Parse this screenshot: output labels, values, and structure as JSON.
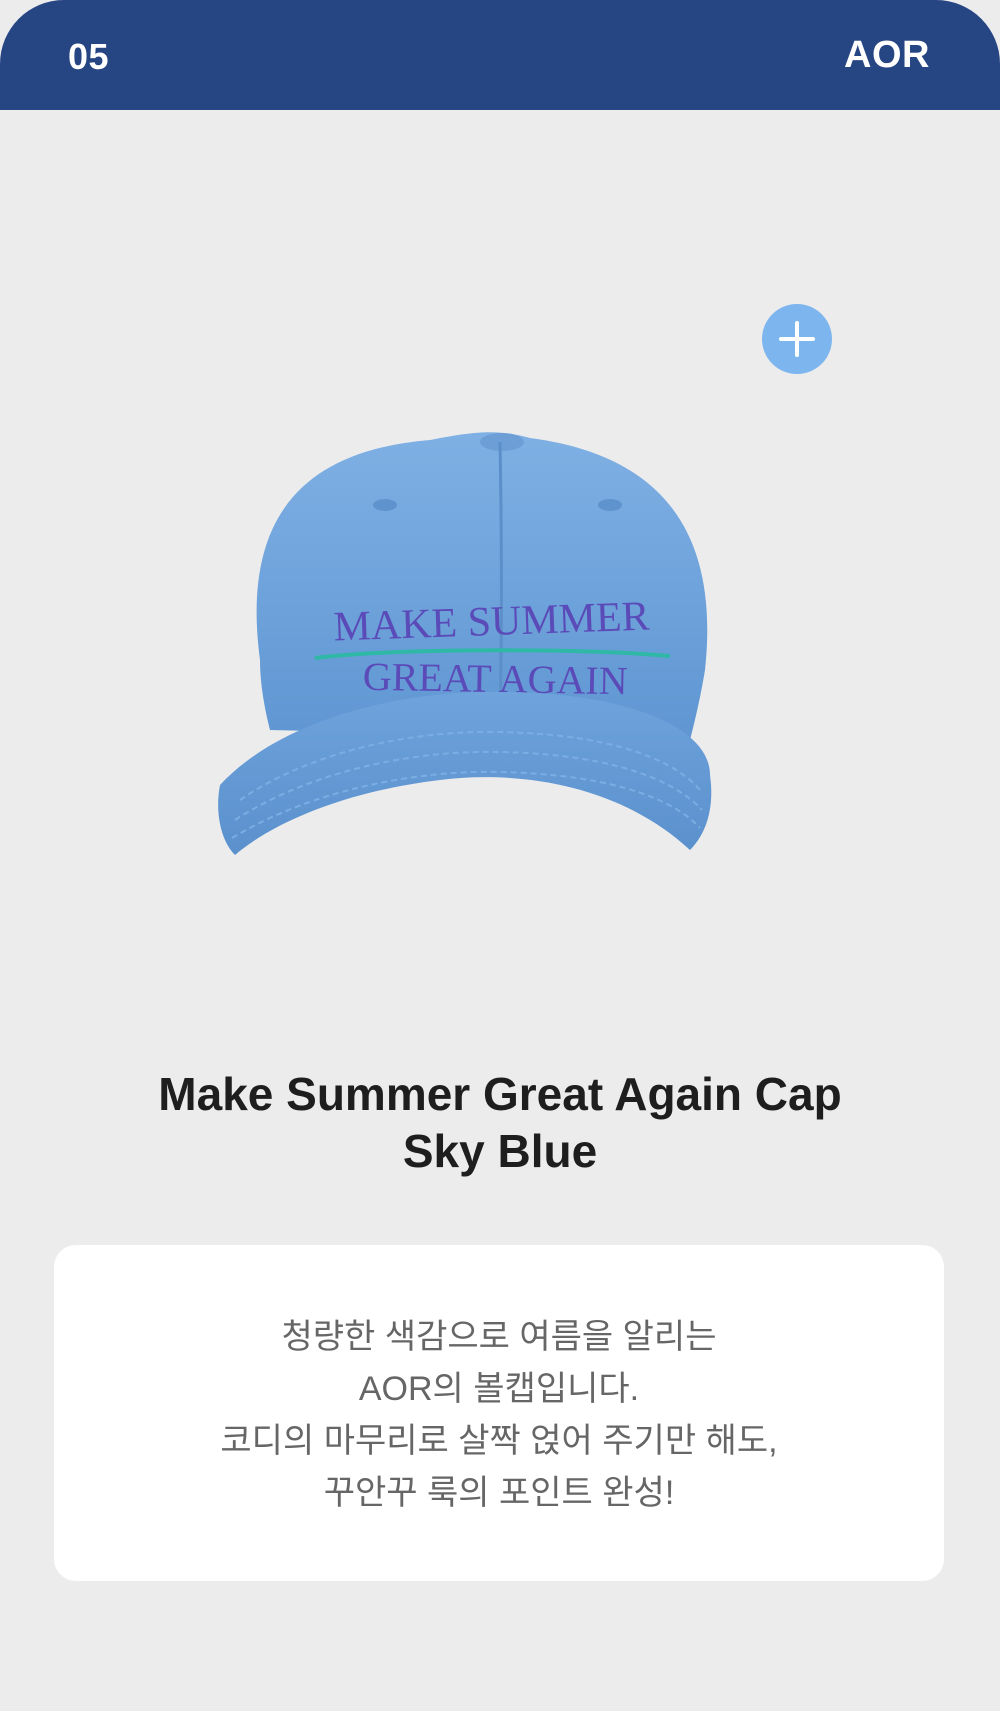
{
  "header": {
    "number": "05",
    "brand": "AOR",
    "background_color": "#264583"
  },
  "product": {
    "image_alt": "Sky blue baseball cap embroidered with MAKE SUMMER GREAT AGAIN",
    "embroidery_line1": "MAKE SUMMER",
    "embroidery_line2": "GREAT AGAIN",
    "cap_color": "#6ea3dc",
    "embroidery_color": "#5b4bb8",
    "stripe_color": "#2fb8a6",
    "add_button_icon": "plus-icon",
    "add_button_color": "#7db6ee",
    "title_line1": "Make Summer Great Again Cap",
    "title_line2": "Sky Blue"
  },
  "description": {
    "lines": [
      "청량한 색감으로 여름을 알리는",
      "AOR의 볼캡입니다.",
      "코디의 마무리로 살짝 얹어 주기만 해도,",
      "꾸안꾸 룩의 포인트 완성!"
    ]
  }
}
